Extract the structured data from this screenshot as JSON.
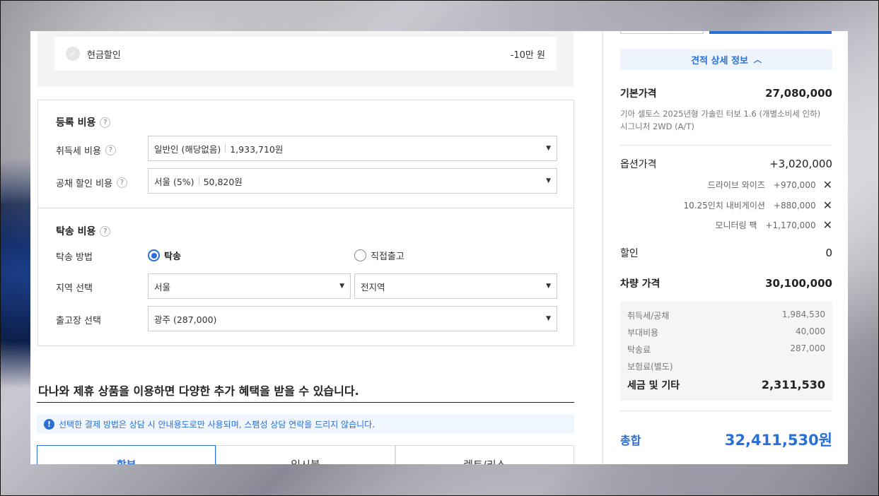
{
  "cash_discount": {
    "label": "현금할인",
    "amount": "-10만 원"
  },
  "registration": {
    "title": "등록 비용",
    "acquisition_tax": {
      "label": "취득세 비용",
      "option": "일반인 (해당없음)",
      "amount": "1,933,710원"
    },
    "bond_discount": {
      "label": "공채 할인 비용",
      "option": "서울 (5%)",
      "amount": "50,820원"
    }
  },
  "delivery": {
    "title": "탁송 비용",
    "method_label": "탁송 방법",
    "method_options": [
      "탁송",
      "직접출고"
    ],
    "selected_method": "탁송",
    "region_label": "지역 선택",
    "region_city": "서울",
    "region_district": "전지역",
    "depot_label": "출고장 선택",
    "depot_value": "광주 (287,000)"
  },
  "promo": {
    "title": "다나와 제휴 상품을 이용하면 다양한 추가 혜택을 받을 수 있습니다.",
    "notice": "선택한 결제 방법은 상담 시 안내용도로만 사용되며, 스팸성 상담 연락을 드리지 않습니다.",
    "tabs": [
      "할부",
      "일시불",
      "렌트/리스"
    ]
  },
  "summary": {
    "detail_toggle": "견적 상세 정보",
    "base_price_label": "기본가격",
    "base_price": "27,080,000",
    "model_desc": "기아 셀토스 2025년형 가솔린 터보 1.6 (개별소비세 인하) 시그니처 2WD (A/T)",
    "option_price_label": "옵션가격",
    "option_price": "+3,020,000",
    "options": [
      {
        "name": "드라이브 와이즈",
        "price": "+970,000"
      },
      {
        "name": "10.25인치 내비게이션",
        "price": "+880,000"
      },
      {
        "name": "모니터링 팩",
        "price": "+1,170,000"
      }
    ],
    "discount_label": "할인",
    "discount": "0",
    "vehicle_price_label": "차량 가격",
    "vehicle_price": "30,100,000",
    "taxes": [
      {
        "label": "취득세/공채",
        "value": "1,984,530"
      },
      {
        "label": "부대비용",
        "value": "40,000"
      },
      {
        "label": "탁송료",
        "value": "287,000"
      },
      {
        "label": "보험료(별도)",
        "value": ""
      }
    ],
    "tax_total_label": "세금 및 기타",
    "tax_total": "2,311,530",
    "grand_total_label": "총합",
    "grand_total": "32,411,530원"
  }
}
